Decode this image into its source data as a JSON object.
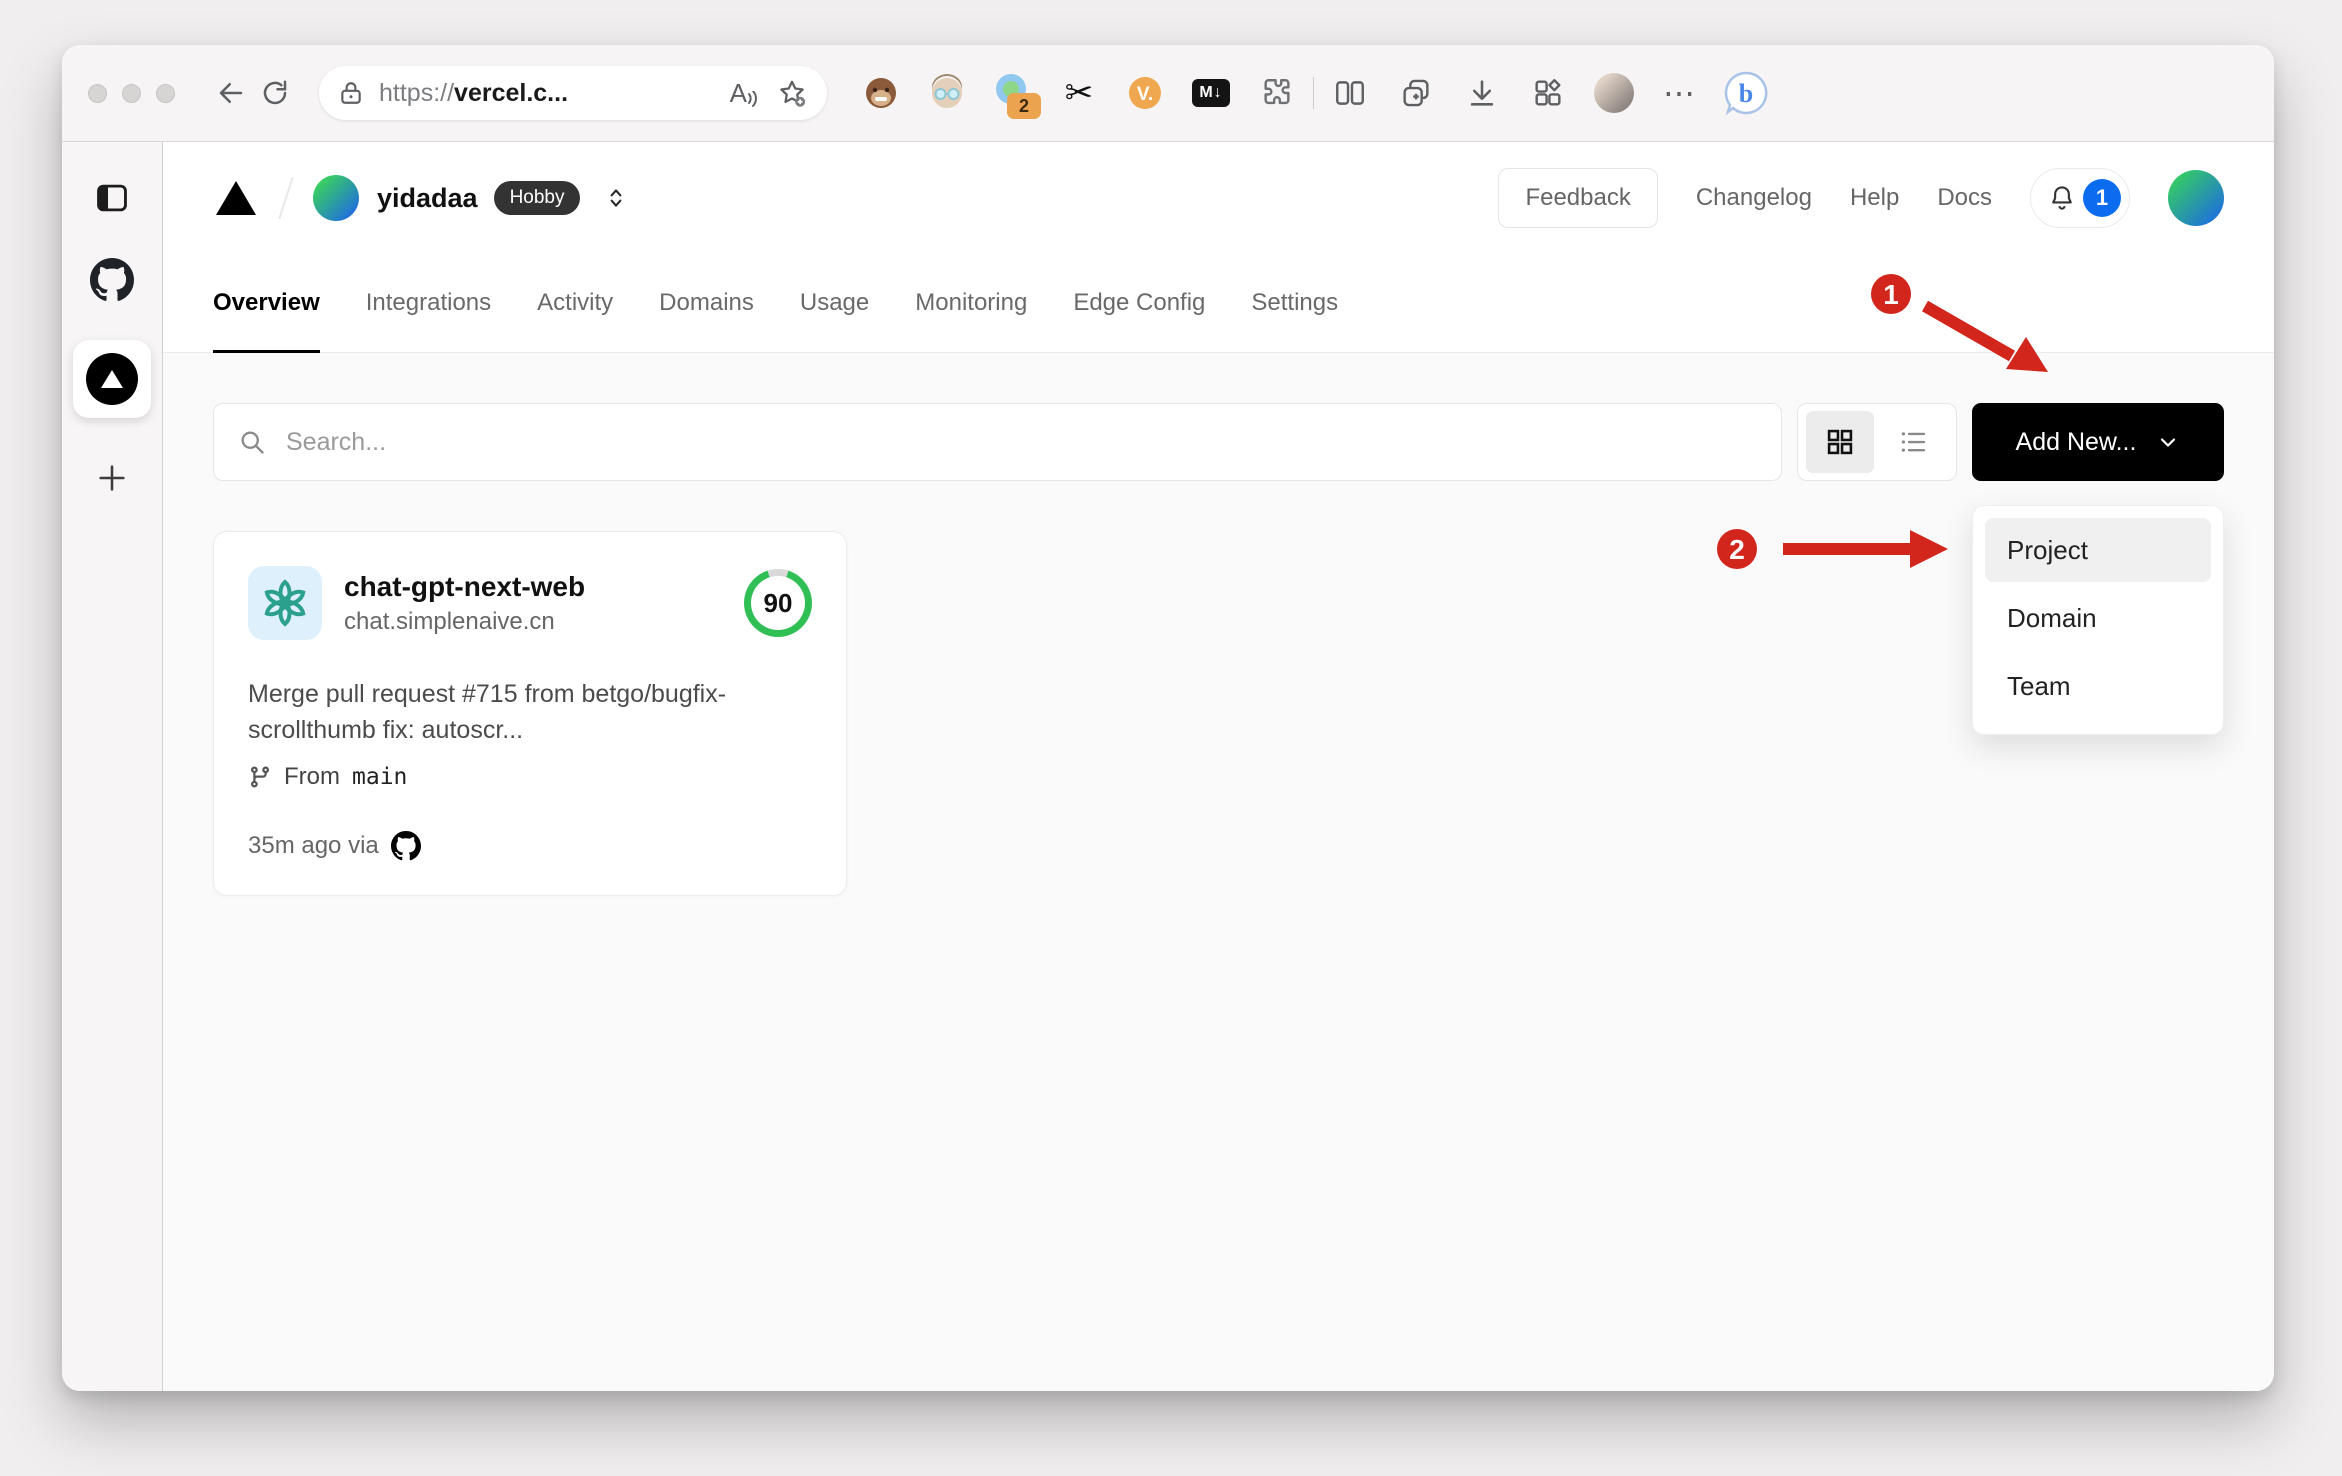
{
  "browser": {
    "url": {
      "protocol": "https://",
      "host": "vercel.c..."
    },
    "icons": {
      "extension_badge": "2",
      "scissors_glyph": "✂",
      "vc_label": "V.",
      "md_label": "M↓",
      "more_glyph": "⋯",
      "readaloud_letter": "A",
      "bing_letter": "b"
    }
  },
  "vercel": {
    "team": "yidadaa",
    "plan": "Hobby",
    "feedback": "Feedback",
    "nav_links": [
      "Changelog",
      "Help",
      "Docs"
    ],
    "notification_count": "1",
    "tabs": [
      "Overview",
      "Integrations",
      "Activity",
      "Domains",
      "Usage",
      "Monitoring",
      "Edge Config",
      "Settings"
    ],
    "search_placeholder": "Search...",
    "add_new_label": "Add New...",
    "dropdown_items": [
      "Project",
      "Domain",
      "Team"
    ],
    "project": {
      "name": "chat-gpt-next-web",
      "domain": "chat.simplenaive.cn",
      "score": "90",
      "commit": "Merge pull request #715 from betgo/bugfix-scrollthumb fix: autoscr...",
      "from_label": "From",
      "branch": "main",
      "deployed": "35m ago via"
    }
  },
  "annotations": {
    "step1": "1",
    "step2": "2"
  },
  "colors": {
    "accent_red": "#d2251c",
    "score_green": "#2fbf55",
    "notification_blue": "#0b6cf0",
    "button_black": "#000000"
  }
}
